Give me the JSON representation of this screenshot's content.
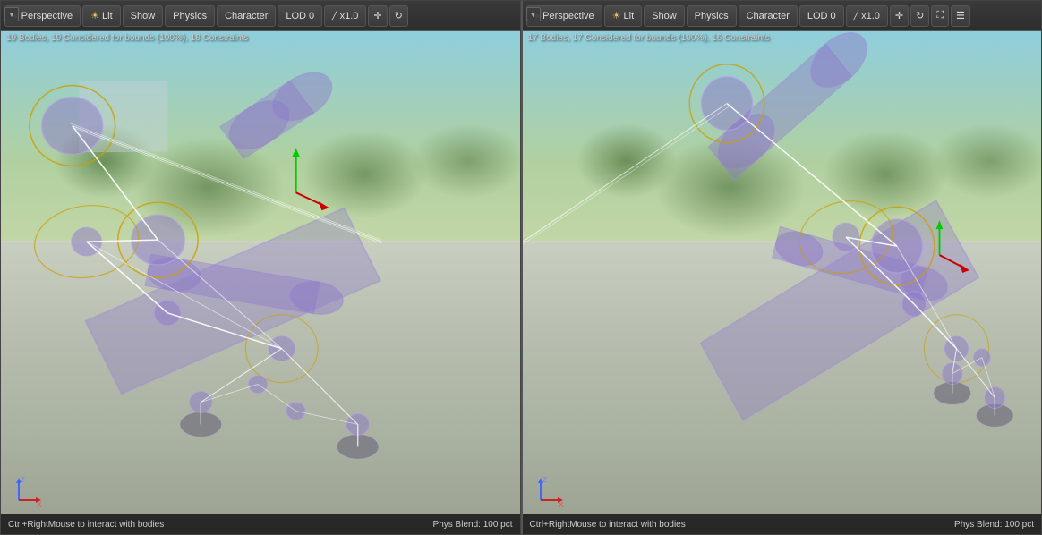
{
  "viewports": [
    {
      "id": "left",
      "dropdown_arrow": "▼",
      "perspective_icon": "●",
      "perspective_label": "Perspective",
      "lit_label": "Lit",
      "show_label": "Show",
      "physics_label": "Physics",
      "character_label": "Character",
      "lod_label": "LOD 0",
      "scale_label": "x1.0",
      "move_icon": "✛",
      "rotate_icon": "↻",
      "info_text": "19 Bodies, 19 Considered for bounds (100%), 18 Constraints",
      "status_left": "Ctrl+RightMouse to interact with bodies",
      "status_right": "Phys Blend: 100 pct",
      "axis_x": "X",
      "axis_y": "Z"
    },
    {
      "id": "right",
      "dropdown_arrow": "▼",
      "perspective_icon": "●",
      "perspective_label": "Perspective",
      "lit_label": "Lit",
      "show_label": "Show",
      "physics_label": "Physics",
      "character_label": "Character",
      "lod_label": "LOD 0",
      "scale_label": "x1.0",
      "move_icon": "✛",
      "rotate_icon": "↻",
      "info_text": "17 Bodies, 17 Considered for bounds (100%), 16 Constraints",
      "status_left": "Ctrl+RightMouse to interact with bodies",
      "status_right": "Phys Blend: 100 pct",
      "axis_x": "X",
      "axis_y": "Z"
    }
  ],
  "icons": {
    "dropdown": "▼",
    "perspective_sphere": "◉",
    "lit_bulb": "☀",
    "eye": "◉",
    "move": "⊕",
    "rotate": "↻",
    "maximize": "⛶",
    "settings": "⚙"
  },
  "colors": {
    "toolbar_bg": "#2d2d2d",
    "toolbar_border": "#555",
    "btn_bg": "#3d3d3d",
    "btn_border": "#555",
    "text_main": "#dddddd",
    "text_dim": "#aaaaaa",
    "status_bg": "rgba(20,20,20,0.85)",
    "physics_yellow": "#d4a000",
    "physics_white": "#ffffff",
    "physics_purple": "rgba(140,120,200,0.5)",
    "axis_x_color": "#cc2222",
    "axis_z_color": "#2222cc"
  }
}
